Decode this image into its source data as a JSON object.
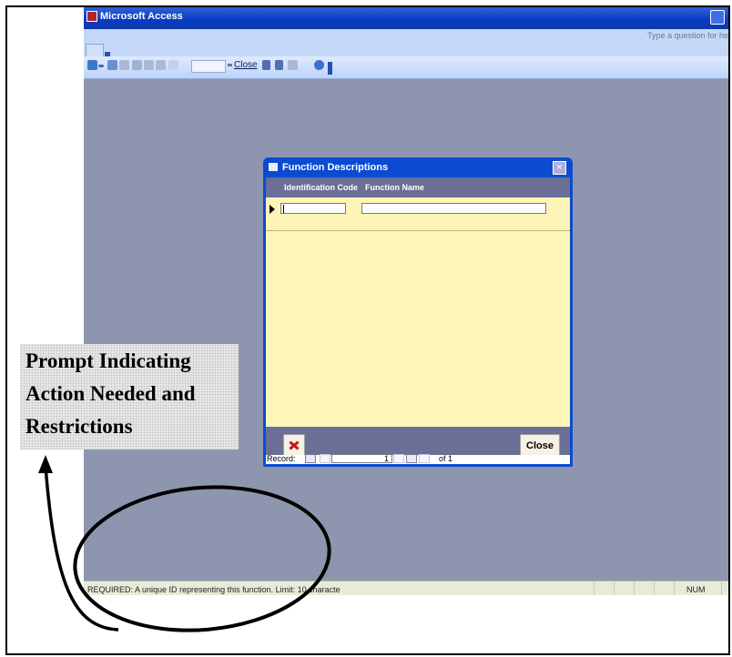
{
  "app": {
    "title": "Microsoft Access",
    "ask_placeholder": "Type a question for hel"
  },
  "toolbar": {
    "close_label": "Close",
    "zoom_value": ""
  },
  "form": {
    "title": "Function Descriptions",
    "columns": [
      "Identification Code",
      "Function Name"
    ],
    "record": {
      "identification_code": "",
      "function_name": ""
    },
    "close_button": "Close",
    "navigation": {
      "label": "Record:",
      "current": "1",
      "total": "of 1"
    }
  },
  "statusbar": {
    "text": "REQUIRED:  A unique ID representing this function.   Limit: 10 characte",
    "num": "NUM"
  },
  "annotation": {
    "lines": [
      "Prompt Indicating",
      "Action Needed and",
      "Restrictions"
    ]
  },
  "icons": {
    "app_logo": "access-logo-icon",
    "view": "view-icon",
    "print": "print-icon",
    "sort_asc": "sort-ascending-icon",
    "sort_desc": "sort-descending-icon",
    "help": "help-icon",
    "delete": "delete-record-icon",
    "nav_first": "first-record-icon",
    "nav_last": "last-record-icon"
  },
  "colors": {
    "title_bar": "#0a4bd2",
    "workspace": "#8e95ae",
    "form_body": "#fff7b7",
    "form_header": "#6b6f95",
    "annotation_ink": "#000000"
  }
}
